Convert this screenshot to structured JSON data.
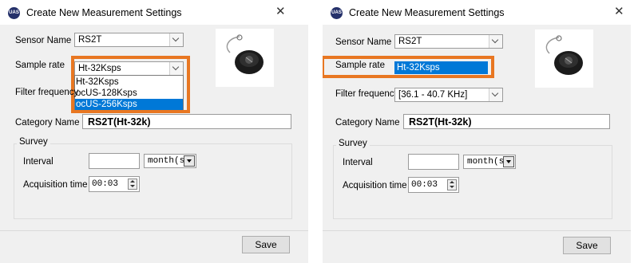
{
  "dialog_title": "Create New Measurement Settings",
  "app_icon_text": "UAS",
  "close_glyph": "✕",
  "labels": {
    "sensor_name": "Sensor Name",
    "sample_rate": "Sample rate",
    "filter_frequency": "Filter frequency",
    "category_name": "Category Name",
    "survey": "Survey",
    "interval": "Interval",
    "acquisition_time": "Acquisition time"
  },
  "sensor_name_value": "RS2T",
  "sample_rate_value": "Ht-32Ksps",
  "sample_rate_options": [
    "Ht-32Ksps",
    "ocUS-128Ksps",
    "ocUS-256Ksps"
  ],
  "sample_rate_highlighted_option": "ocUS-256Ksps",
  "filter_frequency_value": "[36.1 - 40.7 KHz]",
  "category_name_value": "RS2T(Ht-32k)",
  "interval_value": "",
  "interval_unit": "month(s)",
  "acquisition_time_value": "00:03",
  "save_label": "Save",
  "colors": {
    "highlight": "#e87722",
    "selection": "#0078d7",
    "dialog_bg": "#f0f0f0"
  }
}
